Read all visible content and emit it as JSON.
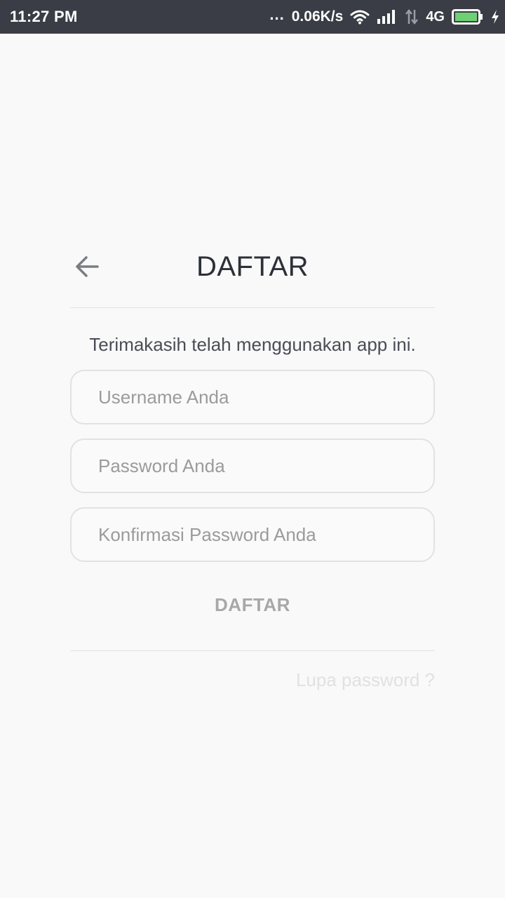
{
  "status_bar": {
    "time": "11:27 PM",
    "dots": "...",
    "net_speed": "0.06K/s",
    "network_type": "4G",
    "battery_color": "#6fcf73",
    "icons": [
      "wifi-icon",
      "signal-icon",
      "data-arrows-icon",
      "battery-icon",
      "charging-bolt-icon"
    ]
  },
  "header": {
    "title": "DAFTAR",
    "back_icon": "arrow-left-icon"
  },
  "form": {
    "subtitle": "Terimakasih telah menggunakan app ini.",
    "username_placeholder": "Username Anda",
    "username_value": "",
    "password_placeholder": "Password Anda",
    "password_value": "",
    "confirm_password_placeholder": "Konfirmasi Password Anda",
    "confirm_password_value": "",
    "submit_label": "DAFTAR",
    "forgot_label": "Lupa password ?"
  }
}
